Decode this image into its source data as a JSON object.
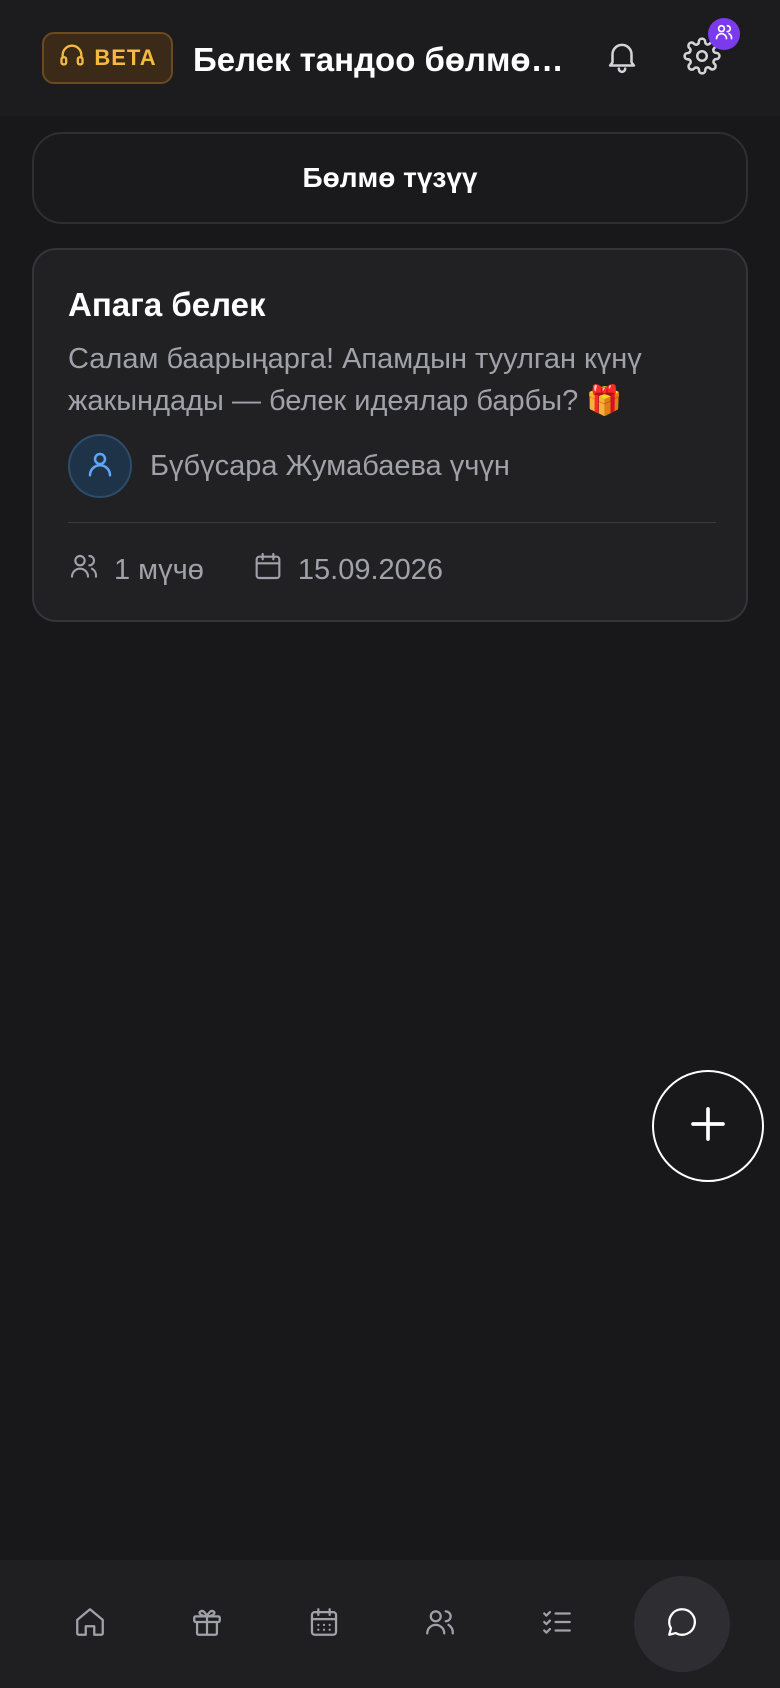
{
  "header": {
    "beta_label": "BETA",
    "title": "Белек тандоо бөлмөлө...",
    "beta_icon": "headset-icon",
    "notifications_icon": "bell-icon",
    "settings_icon": "gear-icon",
    "badge_icon": "users-icon"
  },
  "actions": {
    "create_room_label": "Бөлмө түзүү"
  },
  "rooms": [
    {
      "title": "Апага белек",
      "description": "Салам баарыңарга! Апамдын туулган күнү жакындады — белек идеялар барбы? 🎁",
      "for_text": "Бүбүсара Жумабаева үчүн",
      "members": "1 мүчө",
      "date": "15.09.2026"
    }
  ],
  "fab": {
    "icon": "plus-icon"
  },
  "nav": {
    "items": [
      "home-icon",
      "gift-icon",
      "calendar-icon",
      "users-icon",
      "tasks-icon",
      "chat-icon"
    ]
  },
  "colors": {
    "background": "#18181b",
    "card": "#212124",
    "beta_accent": "#f5b942",
    "badge_purple": "#7c3aed",
    "muted_text": "#a1a1aa",
    "avatar_icon": "#60a5fa"
  }
}
